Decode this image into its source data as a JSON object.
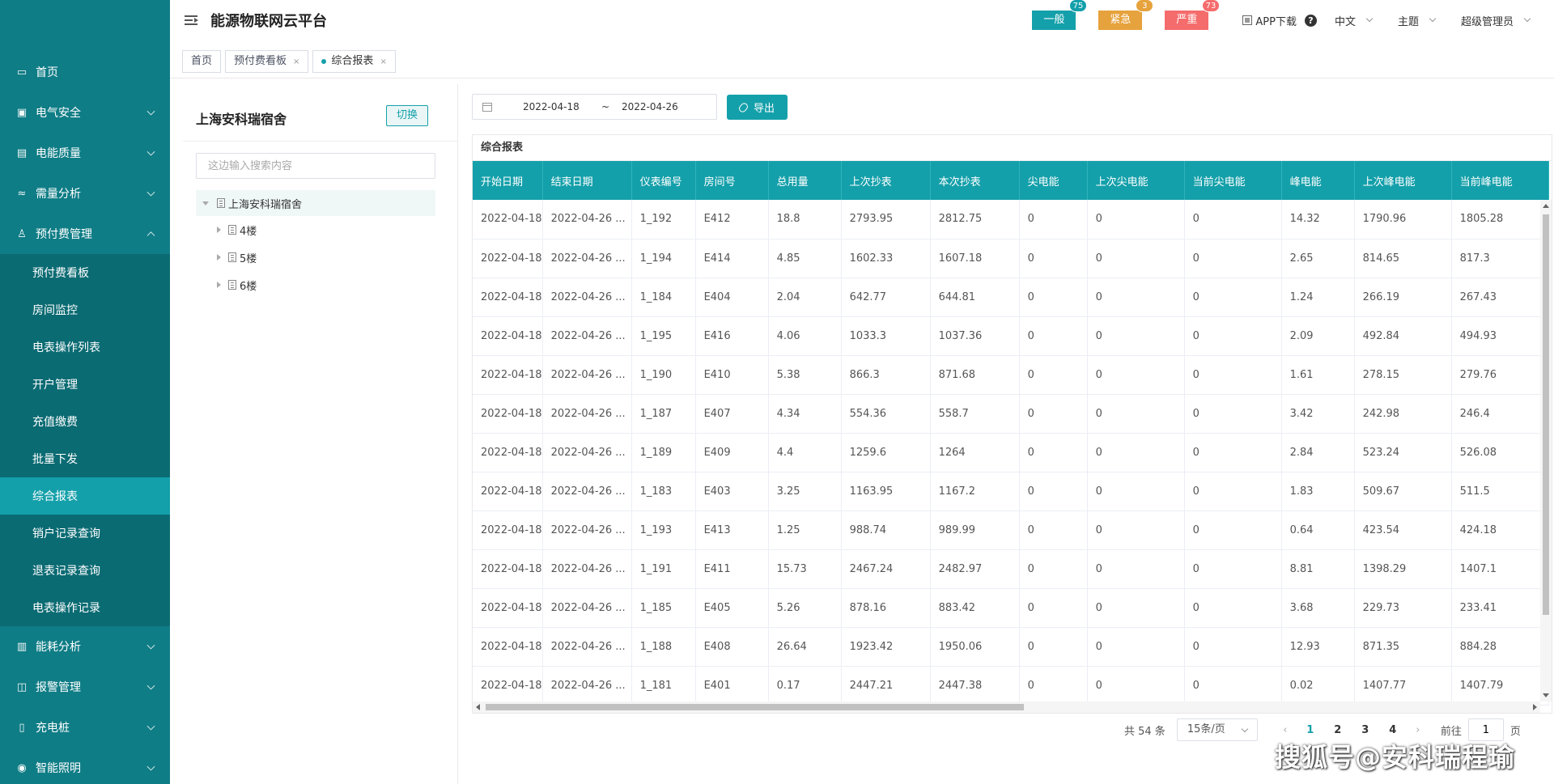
{
  "app": {
    "title": "能源物联网云平台"
  },
  "header": {
    "alarms": [
      {
        "label": "一般",
        "count": "75",
        "color": "#14a0aa",
        "badge": "#14a0aa"
      },
      {
        "label": "紧急",
        "count": "3",
        "color": "#e6a23c",
        "badge": "#e6a23c"
      },
      {
        "label": "严重",
        "count": "73",
        "color": "#f56c6c",
        "badge": "#f56c6c"
      }
    ],
    "app_download": "APP下载",
    "language": "中文",
    "theme": "主题",
    "user": "超级管理员"
  },
  "sidebar": {
    "items": [
      {
        "label": "首页",
        "icon": "▭"
      },
      {
        "label": "电气安全",
        "icon": "▣"
      },
      {
        "label": "电能质量",
        "icon": "▤"
      },
      {
        "label": "需量分析",
        "icon": "≈"
      },
      {
        "label": "预付费管理",
        "icon": "♙"
      }
    ],
    "sub_items": [
      "预付费看板",
      "房间监控",
      "电表操作列表",
      "开户管理",
      "充值缴费",
      "批量下发",
      "综合报表",
      "销户记录查询",
      "退表记录查询",
      "电表操作记录"
    ],
    "bottom_items": [
      {
        "label": "能耗分析",
        "icon": "▥"
      },
      {
        "label": "报警管理",
        "icon": "◫"
      },
      {
        "label": "充电桩",
        "icon": "▯"
      },
      {
        "label": "智能照明",
        "icon": "◉"
      }
    ]
  },
  "tabs": [
    {
      "label": "首页"
    },
    {
      "label": "预付费看板",
      "close": "×"
    },
    {
      "label": "综合报表",
      "close": "×"
    }
  ],
  "tree": {
    "site_name": "上海安科瑞宿舍",
    "switch_label": "切换",
    "search_placeholder": "这边输入搜索内容",
    "root": "上海安科瑞宿舍",
    "children": [
      "4楼",
      "5楼",
      "6楼"
    ]
  },
  "filters": {
    "start_date": "2022-04-18",
    "separator": "~",
    "end_date": "2022-04-26",
    "export_label": "导出"
  },
  "table": {
    "title": "综合报表",
    "columns": [
      "开始日期",
      "结束日期",
      "仪表编号",
      "房间号",
      "总用量",
      "上次抄表",
      "本次抄表",
      "尖电能",
      "上次尖电能",
      "当前尖电能",
      "峰电能",
      "上次峰电能",
      "当前峰电能"
    ],
    "rows": [
      [
        "2022-04-18",
        "2022-04-26 ...",
        "1_192",
        "E412",
        "18.8",
        "2793.95",
        "2812.75",
        "0",
        "0",
        "0",
        "14.32",
        "1790.96",
        "1805.28"
      ],
      [
        "2022-04-18",
        "2022-04-26 ...",
        "1_194",
        "E414",
        "4.85",
        "1602.33",
        "1607.18",
        "0",
        "0",
        "0",
        "2.65",
        "814.65",
        "817.3"
      ],
      [
        "2022-04-18",
        "2022-04-26 ...",
        "1_184",
        "E404",
        "2.04",
        "642.77",
        "644.81",
        "0",
        "0",
        "0",
        "1.24",
        "266.19",
        "267.43"
      ],
      [
        "2022-04-18",
        "2022-04-26 ...",
        "1_195",
        "E416",
        "4.06",
        "1033.3",
        "1037.36",
        "0",
        "0",
        "0",
        "2.09",
        "492.84",
        "494.93"
      ],
      [
        "2022-04-18",
        "2022-04-26 ...",
        "1_190",
        "E410",
        "5.38",
        "866.3",
        "871.68",
        "0",
        "0",
        "0",
        "1.61",
        "278.15",
        "279.76"
      ],
      [
        "2022-04-18",
        "2022-04-26 ...",
        "1_187",
        "E407",
        "4.34",
        "554.36",
        "558.7",
        "0",
        "0",
        "0",
        "3.42",
        "242.98",
        "246.4"
      ],
      [
        "2022-04-18",
        "2022-04-26 ...",
        "1_189",
        "E409",
        "4.4",
        "1259.6",
        "1264",
        "0",
        "0",
        "0",
        "2.84",
        "523.24",
        "526.08"
      ],
      [
        "2022-04-18",
        "2022-04-26 ...",
        "1_183",
        "E403",
        "3.25",
        "1163.95",
        "1167.2",
        "0",
        "0",
        "0",
        "1.83",
        "509.67",
        "511.5"
      ],
      [
        "2022-04-18",
        "2022-04-26 ...",
        "1_193",
        "E413",
        "1.25",
        "988.74",
        "989.99",
        "0",
        "0",
        "0",
        "0.64",
        "423.54",
        "424.18"
      ],
      [
        "2022-04-18",
        "2022-04-26 ...",
        "1_191",
        "E411",
        "15.73",
        "2467.24",
        "2482.97",
        "0",
        "0",
        "0",
        "8.81",
        "1398.29",
        "1407.1"
      ],
      [
        "2022-04-18",
        "2022-04-26 ...",
        "1_185",
        "E405",
        "5.26",
        "878.16",
        "883.42",
        "0",
        "0",
        "0",
        "3.68",
        "229.73",
        "233.41"
      ],
      [
        "2022-04-18",
        "2022-04-26 ...",
        "1_188",
        "E408",
        "26.64",
        "1923.42",
        "1950.06",
        "0",
        "0",
        "0",
        "12.93",
        "871.35",
        "884.28"
      ],
      [
        "2022-04-18",
        "2022-04-26 ...",
        "1_181",
        "E401",
        "0.17",
        "2447.21",
        "2447.38",
        "0",
        "0",
        "0",
        "0.02",
        "1407.77",
        "1407.79"
      ]
    ]
  },
  "pagination": {
    "total": "共 54 条",
    "page_size": "15条/页",
    "pages": [
      "1",
      "2",
      "3",
      "4"
    ],
    "prev": "‹",
    "next": "›",
    "goto_label": "前往",
    "goto_value": "1",
    "page_suffix": "页"
  },
  "watermark": "搜狐号@安科瑞程瑜",
  "colors": {
    "sidebar": "#0f7d86",
    "accent": "#14a0aa"
  }
}
